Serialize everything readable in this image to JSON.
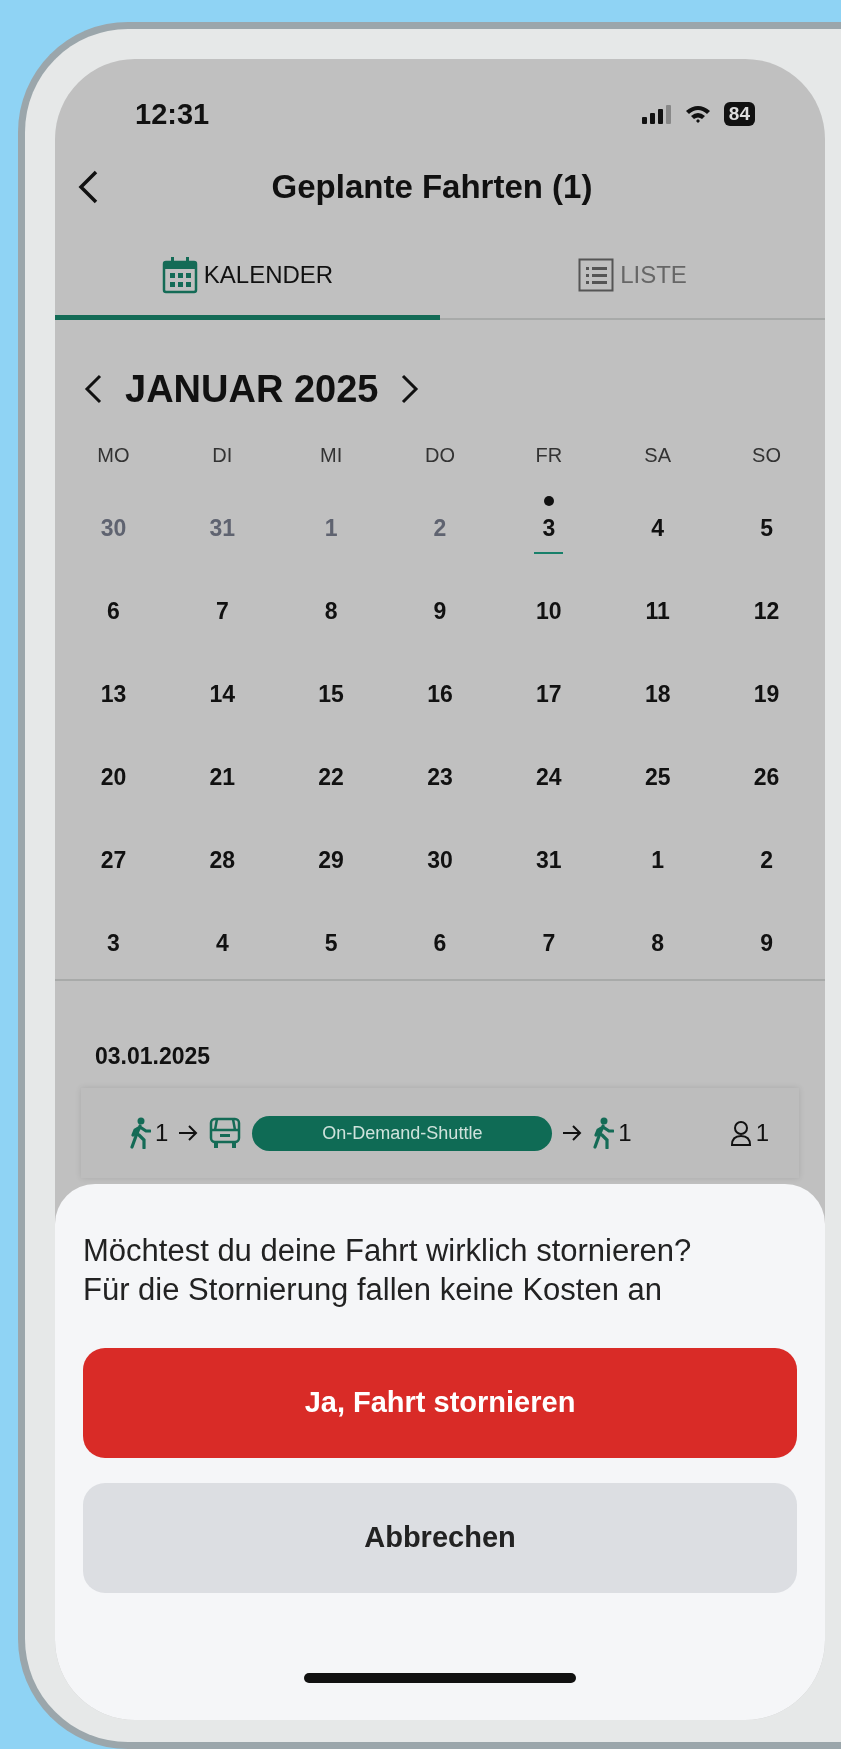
{
  "status_bar": {
    "time": "12:31",
    "battery": "84"
  },
  "header": {
    "title": "Geplante Fahrten (1)"
  },
  "tabs": [
    {
      "label": "KALENDER",
      "kind": "calendar",
      "selected": true
    },
    {
      "label": "LISTE",
      "kind": "list",
      "selected": false
    }
  ],
  "calendar": {
    "month": "JANUAR 2025",
    "weekdays": [
      "MO",
      "DI",
      "MI",
      "DO",
      "FR",
      "SA",
      "SO"
    ],
    "weeks": [
      [
        {
          "label": "30",
          "muted": true,
          "selected": false,
          "has_trip": false
        },
        {
          "label": "31",
          "muted": true,
          "selected": false,
          "has_trip": false
        },
        {
          "label": "1",
          "muted": true,
          "selected": false,
          "has_trip": false
        },
        {
          "label": "2",
          "muted": true,
          "selected": false,
          "has_trip": false
        },
        {
          "label": "3",
          "muted": false,
          "selected": true,
          "has_trip": true
        },
        {
          "label": "4",
          "muted": false,
          "selected": false,
          "has_trip": false
        },
        {
          "label": "5",
          "muted": false,
          "selected": false,
          "has_trip": false
        }
      ],
      [
        {
          "label": "6",
          "muted": false,
          "selected": false,
          "has_trip": false
        },
        {
          "label": "7",
          "muted": false,
          "selected": false,
          "has_trip": false
        },
        {
          "label": "8",
          "muted": false,
          "selected": false,
          "has_trip": false
        },
        {
          "label": "9",
          "muted": false,
          "selected": false,
          "has_trip": false
        },
        {
          "label": "10",
          "muted": false,
          "selected": false,
          "has_trip": false
        },
        {
          "label": "11",
          "muted": false,
          "selected": false,
          "has_trip": false
        },
        {
          "label": "12",
          "muted": false,
          "selected": false,
          "has_trip": false
        }
      ],
      [
        {
          "label": "13",
          "muted": false,
          "selected": false,
          "has_trip": false
        },
        {
          "label": "14",
          "muted": false,
          "selected": false,
          "has_trip": false
        },
        {
          "label": "15",
          "muted": false,
          "selected": false,
          "has_trip": false
        },
        {
          "label": "16",
          "muted": false,
          "selected": false,
          "has_trip": false
        },
        {
          "label": "17",
          "muted": false,
          "selected": false,
          "has_trip": false
        },
        {
          "label": "18",
          "muted": false,
          "selected": false,
          "has_trip": false
        },
        {
          "label": "19",
          "muted": false,
          "selected": false,
          "has_trip": false
        }
      ],
      [
        {
          "label": "20",
          "muted": false,
          "selected": false,
          "has_trip": false
        },
        {
          "label": "21",
          "muted": false,
          "selected": false,
          "has_trip": false
        },
        {
          "label": "22",
          "muted": false,
          "selected": false,
          "has_trip": false
        },
        {
          "label": "23",
          "muted": false,
          "selected": false,
          "has_trip": false
        },
        {
          "label": "24",
          "muted": false,
          "selected": false,
          "has_trip": false
        },
        {
          "label": "25",
          "muted": false,
          "selected": false,
          "has_trip": false
        },
        {
          "label": "26",
          "muted": false,
          "selected": false,
          "has_trip": false
        }
      ],
      [
        {
          "label": "27",
          "muted": false,
          "selected": false,
          "has_trip": false
        },
        {
          "label": "28",
          "muted": false,
          "selected": false,
          "has_trip": false
        },
        {
          "label": "29",
          "muted": false,
          "selected": false,
          "has_trip": false
        },
        {
          "label": "30",
          "muted": false,
          "selected": false,
          "has_trip": false
        },
        {
          "label": "31",
          "muted": false,
          "selected": false,
          "has_trip": false
        },
        {
          "label": "1",
          "muted": false,
          "selected": false,
          "has_trip": false
        },
        {
          "label": "2",
          "muted": false,
          "selected": false,
          "has_trip": false
        }
      ],
      [
        {
          "label": "3",
          "muted": false,
          "selected": false,
          "has_trip": false
        },
        {
          "label": "4",
          "muted": false,
          "selected": false,
          "has_trip": false
        },
        {
          "label": "5",
          "muted": false,
          "selected": false,
          "has_trip": false
        },
        {
          "label": "6",
          "muted": false,
          "selected": false,
          "has_trip": false
        },
        {
          "label": "7",
          "muted": false,
          "selected": false,
          "has_trip": false
        },
        {
          "label": "8",
          "muted": false,
          "selected": false,
          "has_trip": false
        },
        {
          "label": "9",
          "muted": false,
          "selected": false,
          "has_trip": false
        }
      ]
    ]
  },
  "trips": {
    "date": "03.01.2025",
    "legs": [
      {
        "kind": "walk",
        "count": "1"
      },
      {
        "kind": "arrow"
      },
      {
        "kind": "shuttle",
        "label": "On-Demand-Shuttle"
      },
      {
        "kind": "arrow"
      },
      {
        "kind": "walk",
        "count": "1"
      },
      {
        "kind": "passengers",
        "count": "1"
      }
    ]
  },
  "dialog": {
    "message": "Möchtest du deine Fahrt wirklich stornieren? Für die Stornierung fallen keine Kosten an",
    "buttons": [
      {
        "label": "Ja, Fahrt stornieren",
        "kind": "destructive"
      },
      {
        "label": "Abbrechen",
        "kind": "cancel"
      }
    ]
  }
}
